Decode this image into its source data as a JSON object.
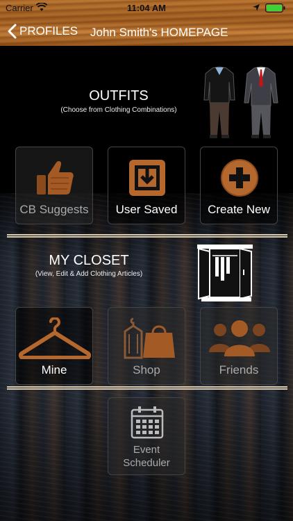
{
  "status_bar": {
    "carrier": "Carrier",
    "time": "11:04 AM"
  },
  "nav": {
    "back_label": "PROFILES",
    "title": "John Smith's HOMEPAGE"
  },
  "outfits": {
    "title": "OUTFITS",
    "subtitle": "(Choose from Clothing Combinations)",
    "tiles": [
      {
        "label": "CB Suggests",
        "icon": "thumbs-up-icon"
      },
      {
        "label": "User Saved",
        "icon": "save-icon"
      },
      {
        "label": "Create New",
        "icon": "plus-circle-icon"
      }
    ]
  },
  "closet": {
    "title": "MY CLOSET",
    "subtitle": "(View, Edit & Add Clothing Articles)",
    "tiles": [
      {
        "label": "Mine",
        "icon": "hanger-icon"
      },
      {
        "label": "Shop",
        "icon": "shopping-bag-icon"
      },
      {
        "label": "Friends",
        "icon": "people-icon"
      }
    ]
  },
  "scheduler": {
    "line1": "Event",
    "line2": "Scheduler",
    "icon": "calendar-icon"
  },
  "colors": {
    "wood": "#a8642a",
    "divider": "#d9cbb0",
    "accent_wood": "#b5682e"
  }
}
